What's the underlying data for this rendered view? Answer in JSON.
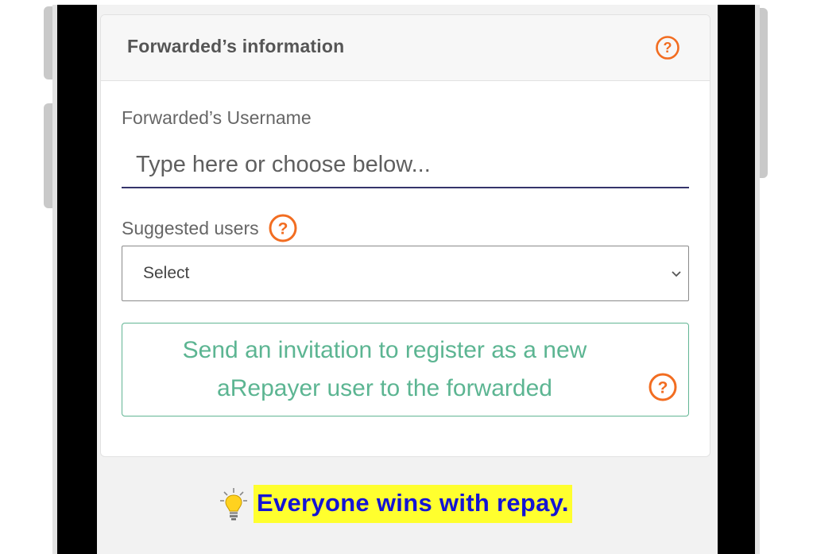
{
  "card": {
    "title": "Forwarded’s information",
    "header_help_icon": "help-circle-icon"
  },
  "username": {
    "label": "Forwarded’s Username",
    "value": "",
    "placeholder": "Type here or choose below..."
  },
  "suggested": {
    "label": "Suggested users",
    "help_icon": "help-circle-icon",
    "selected": "Select",
    "chevron_icon": "chevron-down-icon"
  },
  "invite": {
    "text": "Send an invitation to register as a new aRepayer user to the forwarded",
    "help_icon": "help-circle-icon"
  },
  "tip": {
    "icon": "lightbulb-icon",
    "text": "Everyone wins with repay."
  },
  "colors": {
    "help_orange": "#f26d21",
    "invite_green": "#5cb592",
    "input_underline": "#35346b",
    "tip_highlight": "#ffff2e",
    "tip_text": "#1414d4",
    "phone_frame": "#000000"
  }
}
